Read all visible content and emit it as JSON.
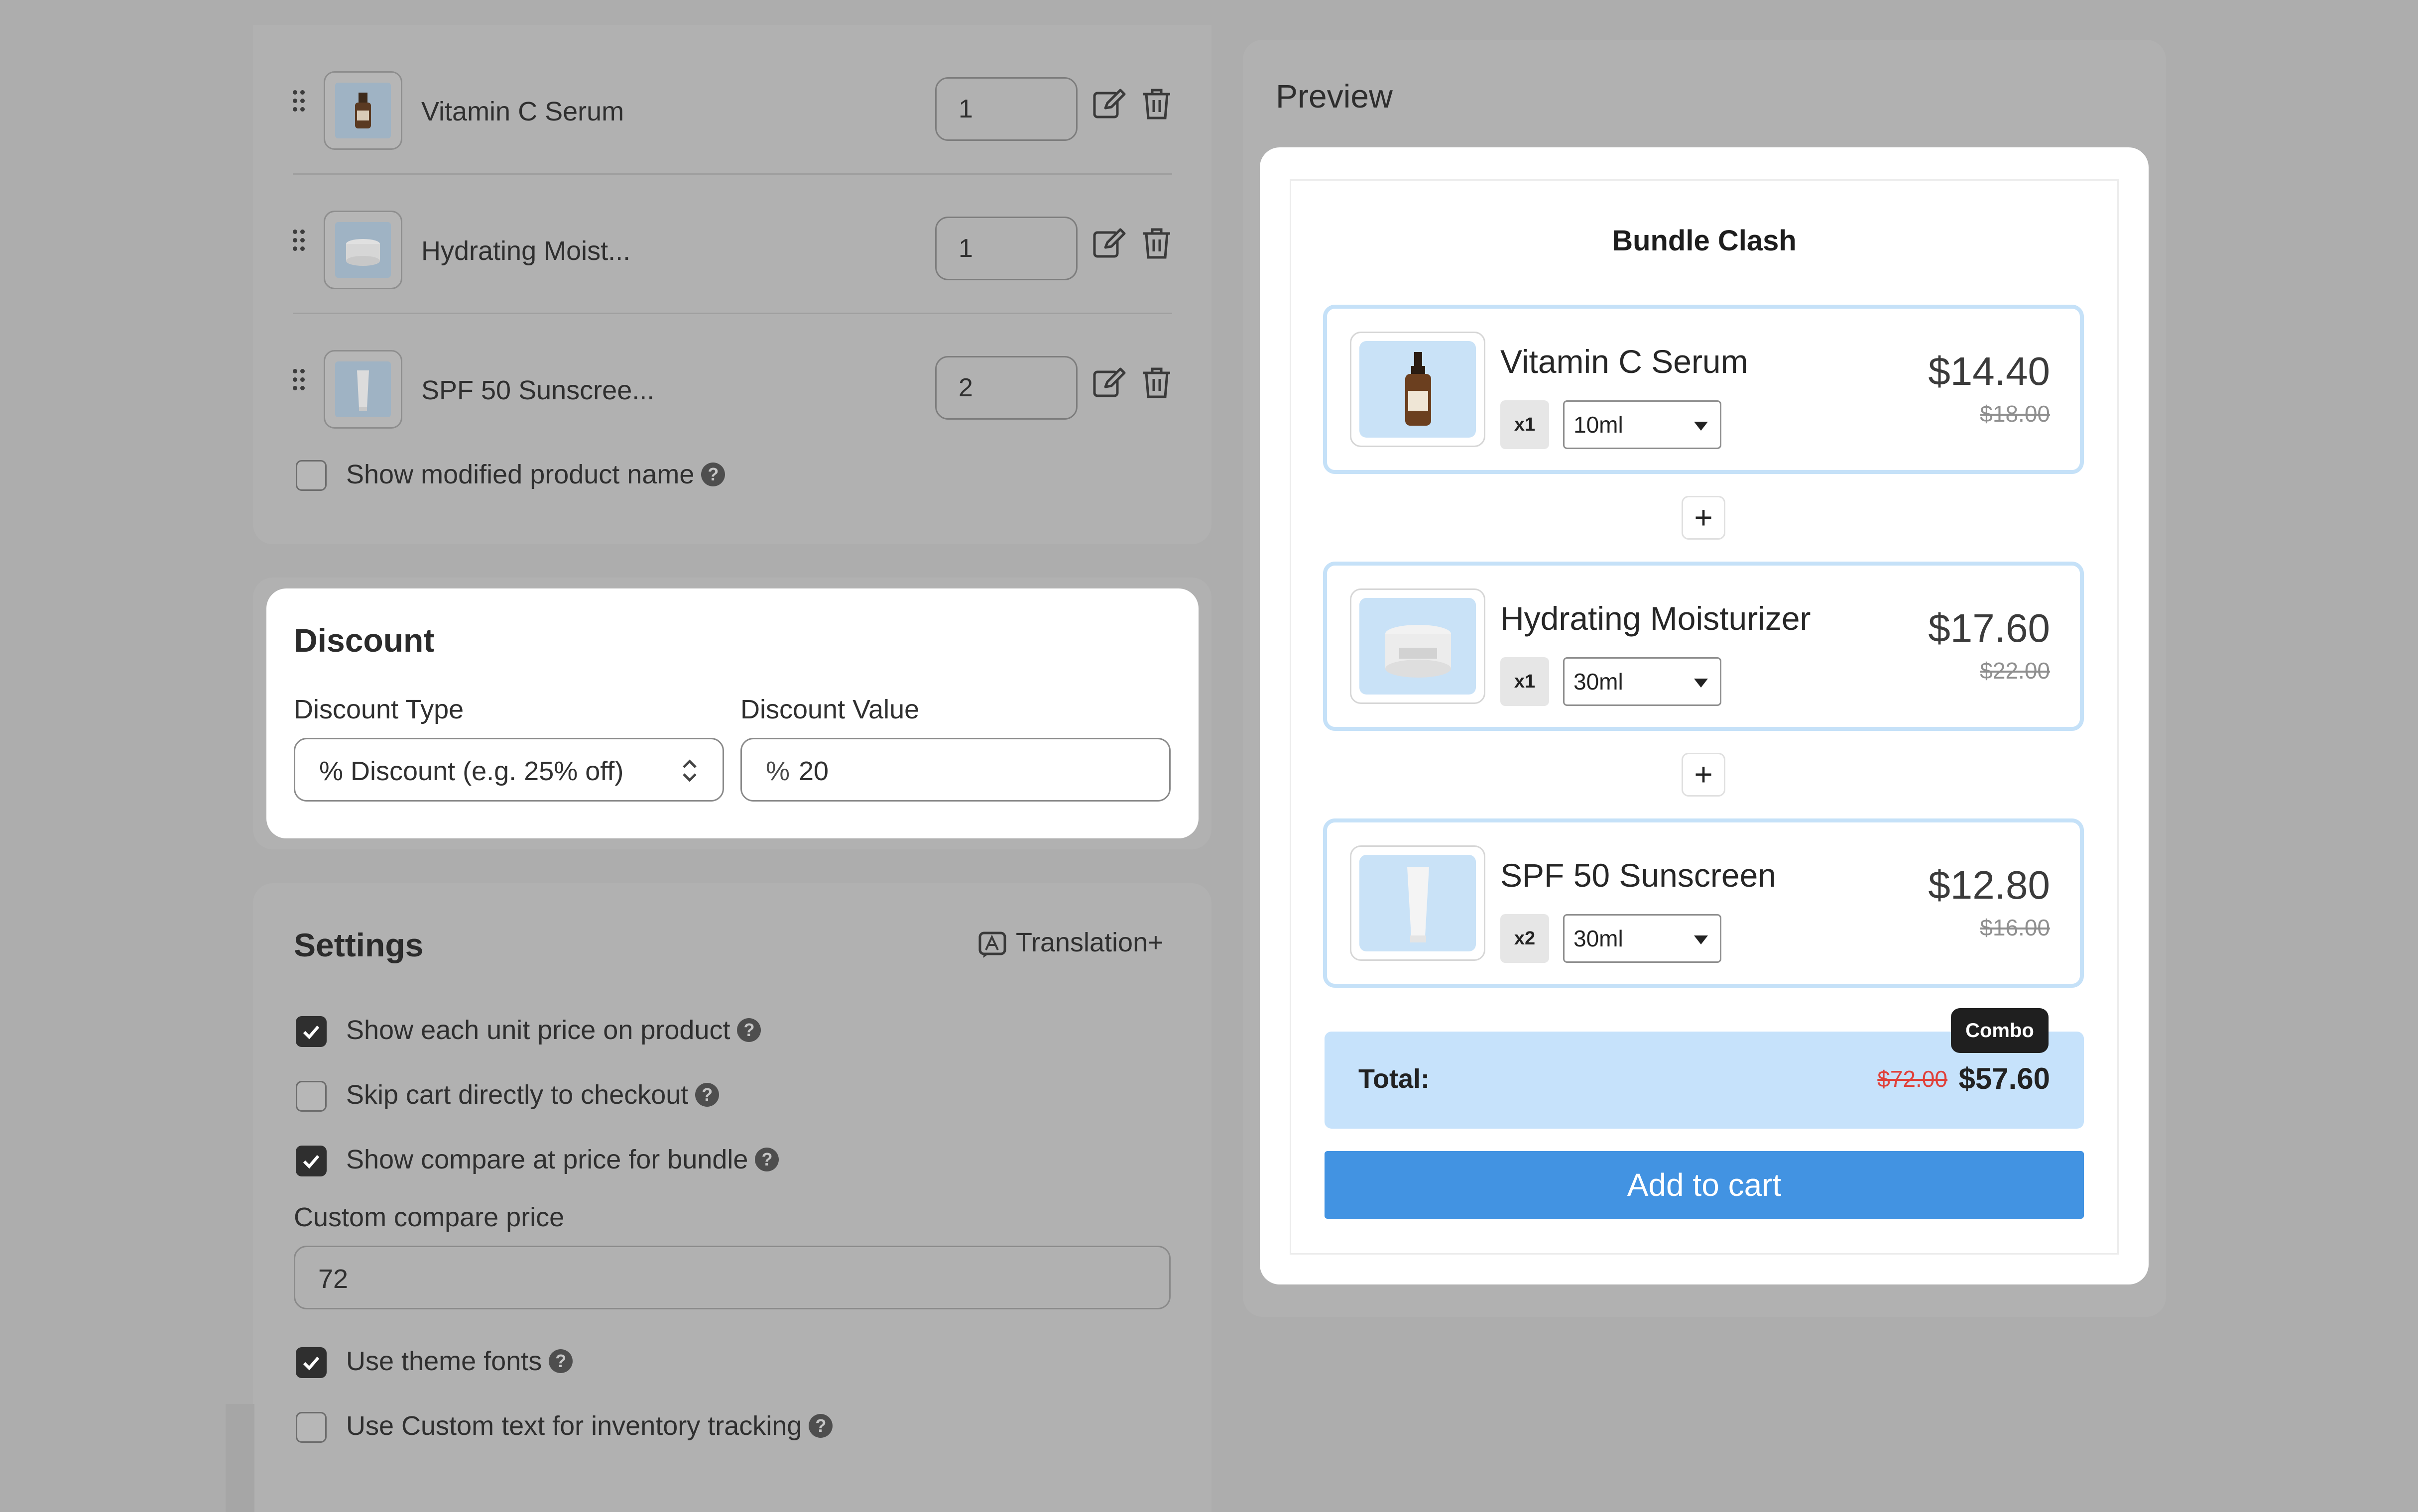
{
  "products": {
    "items": [
      {
        "name": "Vitamin C Serum",
        "qty": "1"
      },
      {
        "name": "Hydrating Moist...",
        "qty": "1"
      },
      {
        "name": "SPF 50 Sunscree...",
        "qty": "2"
      }
    ],
    "show_modified_name": {
      "label": "Show modified product name",
      "checked": false
    }
  },
  "discount": {
    "title": "Discount",
    "type_label": "Discount Type",
    "type_value": "% Discount (e.g. 25% off)",
    "value_label": "Discount Value",
    "value_prefix": "%",
    "value": "20"
  },
  "settings": {
    "title": "Settings",
    "translation_label": "Translation+",
    "options": [
      {
        "label": "Show each unit price on product",
        "checked": true
      },
      {
        "label": "Skip cart directly to checkout",
        "checked": false
      },
      {
        "label": "Show compare at price for bundle",
        "checked": true
      }
    ],
    "custom_compare_label": "Custom compare price",
    "custom_compare_value": "72",
    "options2": [
      {
        "label": "Use theme fonts",
        "checked": true
      },
      {
        "label": "Use Custom text for inventory tracking",
        "checked": false
      }
    ]
  },
  "preview": {
    "title": "Preview",
    "bundle_title": "Bundle Clash",
    "items": [
      {
        "name": "Vitamin C Serum",
        "qty": "x1",
        "variant": "10ml",
        "price": "$14.40",
        "compare_price": "$18.00"
      },
      {
        "name": "Hydrating Moisturizer",
        "qty": "x1",
        "variant": "30ml",
        "price": "$17.60",
        "compare_price": "$22.00"
      },
      {
        "name": "SPF 50 Sunscreen",
        "qty": "x2",
        "variant": "30ml",
        "price": "$12.80",
        "compare_price": "$16.00"
      }
    ],
    "plus_symbol": "+",
    "total_label": "Total:",
    "total_old": "$72.00",
    "total_new": "$57.60",
    "combo_badge": "Combo",
    "add_to_cart": "Add to cart"
  },
  "colors": {
    "accent": "#4293e2",
    "card_border": "#c5e1f8",
    "total_bg": "#c6e2fb",
    "strike_red": "#e0413a"
  }
}
